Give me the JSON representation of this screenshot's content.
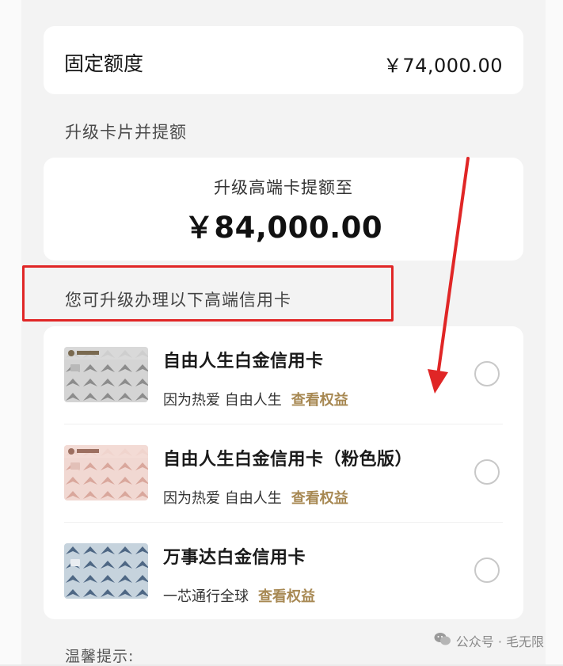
{
  "fixed_limit": {
    "label": "固定额度",
    "value": "￥74,000.00"
  },
  "upgrade_section": {
    "title": "升级卡片并提额",
    "subtitle": "升级高端卡提额至",
    "amount": "￥84,000.00"
  },
  "card_list": {
    "hint": "您可升级办理以下高端信用卡",
    "link_label": "查看权益",
    "cards": [
      {
        "name": "自由人生白金信用卡",
        "desc": "因为热爱 自由人生",
        "selected": false
      },
      {
        "name": "自由人生白金信用卡（粉色版）",
        "desc": "因为热爱 自由人生",
        "selected": false
      },
      {
        "name": "万事达白金信用卡",
        "desc": "一芯通行全球",
        "selected": false
      }
    ]
  },
  "tips": {
    "title": "温馨提示:"
  },
  "watermark": {
    "text": "公众号 · 毛无限",
    "icon": "wechat-icon"
  },
  "colors": {
    "accent_gold": "#a78852",
    "annotation_red": "#e02626",
    "card_silver": "#c9c9c9",
    "card_pink": "#ecc9c2",
    "card_blue": "#b9c9d6"
  }
}
